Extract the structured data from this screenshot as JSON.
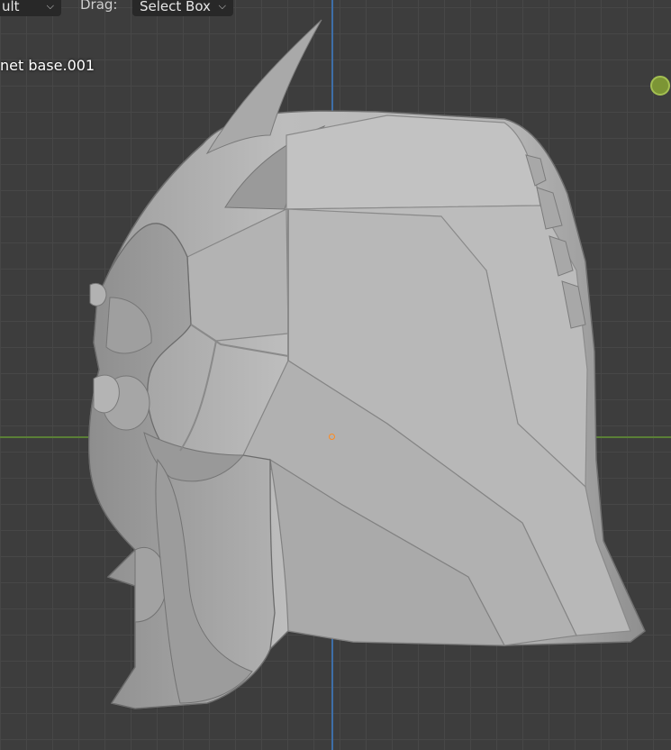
{
  "header": {
    "mode_value": "ult",
    "drag_label": "Drag:",
    "drag_value": "Select Box"
  },
  "viewport": {
    "object_name": "net base.001",
    "navigation_gizmo": "green-axis-ball",
    "origin": "orange-origin-dot"
  },
  "colors": {
    "background": "#3d3d3d",
    "grid": "#474747",
    "x_axis": "#5a7f36",
    "z_axis": "#3e6ea8",
    "mesh": "#b9b9b9",
    "origin": "#ff8a1e"
  },
  "icons": {
    "dropdown": "chevron-down-icon"
  }
}
